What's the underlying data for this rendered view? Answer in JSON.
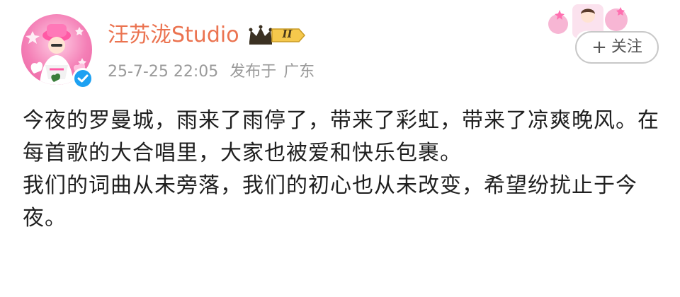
{
  "post": {
    "author": {
      "name": "汪苏泷Studio",
      "level_badge": "II",
      "avatar_icon": "user-avatar",
      "verified_icon": "verified-badge-icon"
    },
    "meta": {
      "timestamp": "25-7-25 22:05",
      "location_prefix": "发布于",
      "location": "广东"
    },
    "follow": {
      "plus": "+",
      "label": "关注"
    },
    "body": {
      "paragraphs": [
        "今夜的罗曼城，雨来了雨停了，带来了彩虹，带来了凉爽晚风。在每首歌的大合唱里，大家也被爱和快乐包裹。",
        "我们的词曲从未旁落，我们的初心也从未改变，希望纷扰止于今夜。"
      ]
    }
  },
  "colors": {
    "name": "#eb7350",
    "meta": "#9a9a9a",
    "body_text": "#1f1f1f",
    "verified": "#1da1f2",
    "badge_gold": "#f5c84c",
    "avatar_pink": "#f47fb6"
  }
}
